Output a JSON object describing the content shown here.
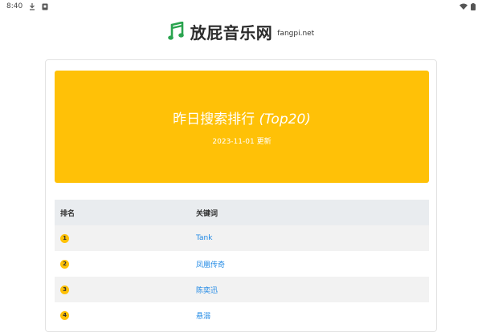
{
  "status_bar": {
    "time": "8:40"
  },
  "header": {
    "site_name": "放屁音乐网",
    "site_domain": "fangpi.net",
    "brand_color": "#2aa44f"
  },
  "hero": {
    "title_main": "昨日搜索排行",
    "title_suffix": "(Top20)",
    "updated": "2023-11-01 更新",
    "color": "#ffc107"
  },
  "table": {
    "headers": [
      "排名",
      "关键词"
    ],
    "rows": [
      {
        "rank": "1",
        "keyword": "Tank"
      },
      {
        "rank": "2",
        "keyword": "凤凰传奇"
      },
      {
        "rank": "3",
        "keyword": "陈奕迅"
      },
      {
        "rank": "4",
        "keyword": "悬溺"
      }
    ]
  }
}
